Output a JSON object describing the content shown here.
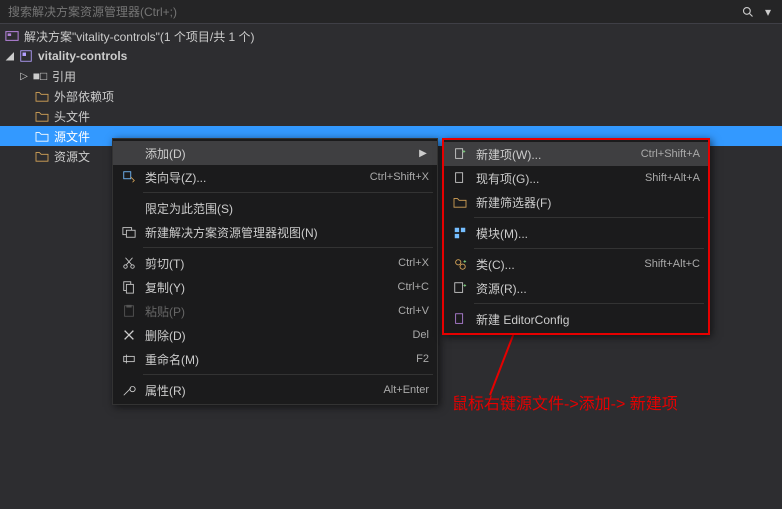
{
  "search": {
    "placeholder": "搜索解决方案资源管理器(Ctrl+;)"
  },
  "solution": {
    "label": "解决方案\"vitality-controls\"(1 个项目/共 1 个)",
    "project": "vitality-controls",
    "nodes": {
      "references": "引用",
      "external": "外部依赖项",
      "headers": "头文件",
      "sources": "源文件",
      "resources": "资源文"
    }
  },
  "menu": {
    "add": "添加(D)",
    "classWizard": "类向导(Z)...",
    "classWizard_sc": "Ctrl+Shift+X",
    "scopeToThis": "限定为此范围(S)",
    "newView": "新建解决方案资源管理器视图(N)",
    "cut": "剪切(T)",
    "cut_sc": "Ctrl+X",
    "copy": "复制(Y)",
    "copy_sc": "Ctrl+C",
    "paste": "粘贴(P)",
    "paste_sc": "Ctrl+V",
    "delete": "删除(D)",
    "delete_sc": "Del",
    "rename": "重命名(M)",
    "rename_sc": "F2",
    "properties": "属性(R)",
    "properties_sc": "Alt+Enter"
  },
  "submenu": {
    "newItem": "新建项(W)...",
    "newItem_sc": "Ctrl+Shift+A",
    "existingItem": "现有项(G)...",
    "existingItem_sc": "Shift+Alt+A",
    "newFilter": "新建筛选器(F)",
    "module": "模块(M)...",
    "class": "类(C)...",
    "class_sc": "Shift+Alt+C",
    "resource": "资源(R)...",
    "editorConfig": "新建 EditorConfig"
  },
  "annotation": "鼠标右键源文件->添加-> 新建项"
}
